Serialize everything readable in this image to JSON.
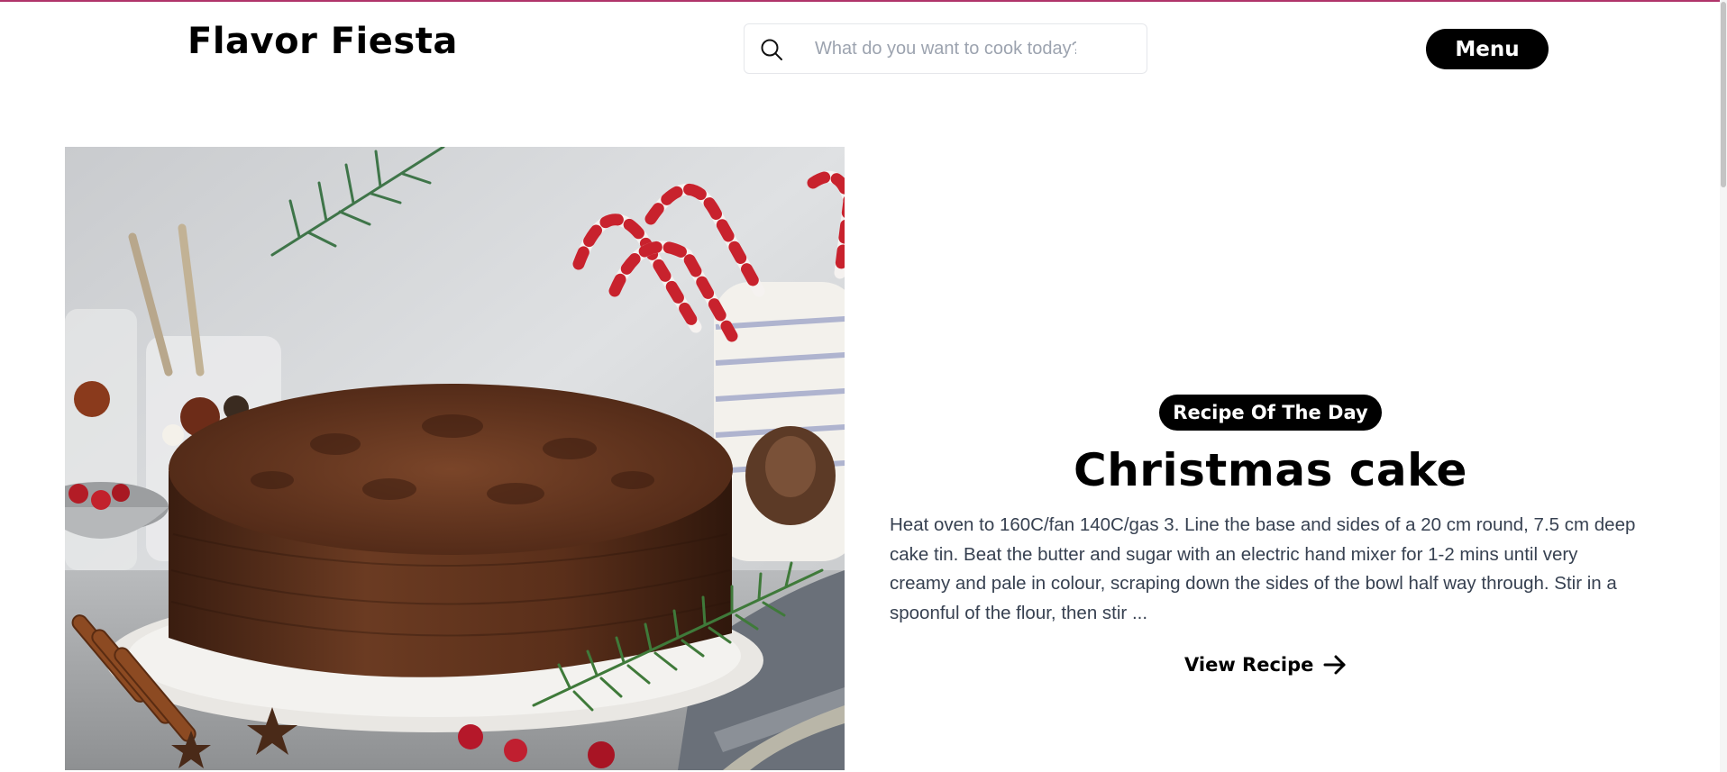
{
  "header": {
    "brand": "Flavor Fiesta",
    "search_placeholder": "What do you want to cook today?",
    "search_value": "",
    "menu_label": "Menu",
    "search_icon": "search-icon"
  },
  "hero": {
    "image_alt": "Christmas cake",
    "badge": "Recipe Of The Day",
    "title": "Christmas cake",
    "description": "Heat oven to 160C/fan 140C/gas 3. Line the base and sides of a 20 cm round, 7.5 cm deep cake tin. Beat the butter and sugar with an electric hand mixer for 1-2 mins until very creamy and pale in colour, scraping down the sides of the bowl half way through. Stir in a spoonful of the flour, then stir ...",
    "cta_label": "View Recipe",
    "cta_icon": "arrow-right-icon"
  },
  "colors": {
    "accent_line": "#b0346a",
    "primary": "#000000",
    "text_muted": "#374151"
  }
}
